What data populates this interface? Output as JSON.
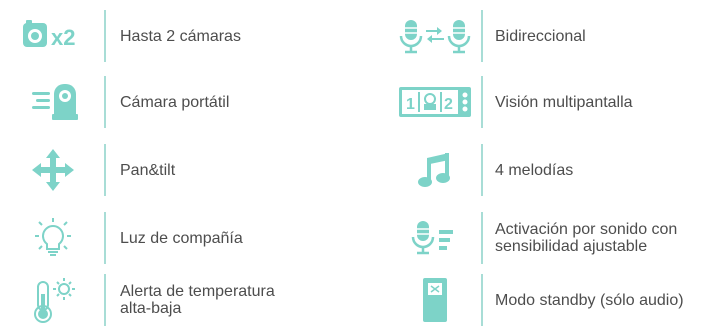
{
  "accent_color": "#7dd3c8",
  "features_left": [
    {
      "icon": "camera-x2-icon",
      "icon_text": "x2",
      "label": "Hasta 2 cámaras"
    },
    {
      "icon": "portable-camera-icon",
      "label": "Cámara portátil"
    },
    {
      "icon": "pan-tilt-arrows-icon",
      "label": "Pan&tilt"
    },
    {
      "icon": "lightbulb-icon",
      "label": "Luz de compañía"
    },
    {
      "icon": "thermometer-icon",
      "label_line1": "Alerta de temperatura",
      "label_line2": "alta-baja"
    }
  ],
  "features_right": [
    {
      "icon": "two-way-microphone-icon",
      "label": "Bidireccional"
    },
    {
      "icon": "multiscreen-icon",
      "icon_text_1": "1",
      "icon_text_2": "2",
      "label": "Visión multipantalla"
    },
    {
      "icon": "music-note-icon",
      "label": "4 melodías"
    },
    {
      "icon": "sound-activation-icon",
      "label_line1": "Activación por sonido con",
      "label_line2": "sensibilidad ajustable"
    },
    {
      "icon": "standby-device-icon",
      "label": "Modo standby (sólo audio)"
    }
  ]
}
